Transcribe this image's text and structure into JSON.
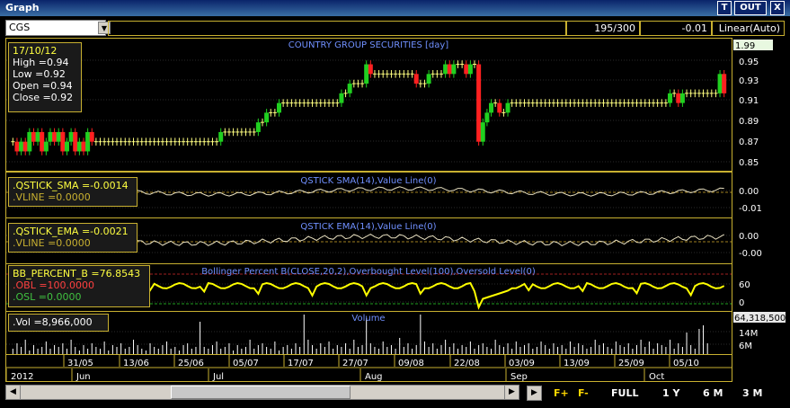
{
  "window": {
    "title": "Graph",
    "buttons": [
      "T",
      "OUT",
      "X"
    ]
  },
  "toolbar": {
    "symbol": "CGS",
    "records": "195/300",
    "change": "-0.01",
    "scale": "Linear(Auto)"
  },
  "price_panel": {
    "title": "COUNTRY GROUP SECURITIES [day]",
    "info": {
      "date": "17/10/12",
      "high": "High  =0.94",
      "low": "Low   =0.92",
      "open": "Open  =0.94",
      "close": "Close =0.92"
    },
    "current": "1.99",
    "ticks": [
      "0.95",
      "0.93",
      "0.91",
      "0.89",
      "0.87",
      "0.85"
    ]
  },
  "sma_panel": {
    "title": "QSTICK SMA(14),Value Line(0)",
    "info": {
      "line1": ".QSTICK_SMA   =-0.0014",
      "line2": ".VLINE  =0.0000"
    },
    "ticks": [
      "0.00",
      "-0.01"
    ]
  },
  "ema_panel": {
    "title": "QSTICK EMA(14),Value Line(0)",
    "info": {
      "line1": ".QSTICK_EMA   =-0.0021",
      "line2": ".VLINE  =0.0000"
    },
    "ticks": [
      "0.00",
      "-0.00"
    ]
  },
  "bb_panel": {
    "title": "Bollinger Percent B(CLOSE,20,2),Overbought Level(100),Oversold Level(0)",
    "info": {
      "line1": "BB_PERCENT_B   =76.8543",
      "line2": ".OBL  =100.0000",
      "line3": ".OSL   =0.0000"
    },
    "ticks": [
      "60",
      "0"
    ]
  },
  "vol_panel": {
    "title": "Volume",
    "info": {
      "line1": ".Vol   =8,966,000"
    },
    "current": "64,318,500",
    "ticks": [
      "14M",
      "6M"
    ]
  },
  "date_axis": {
    "days": [
      "31/05",
      "13/06",
      "25/06",
      "05/07",
      "17/07",
      "27/07",
      "09/08",
      "22/08",
      "03/09",
      "13/09",
      "25/09",
      "05/10"
    ],
    "months": [
      "2012",
      "Jun",
      "Jul",
      "Aug",
      "Sep",
      "Oct"
    ]
  },
  "bottom_buttons": {
    "fplus": "F+",
    "fminus": "F-",
    "full": "FULL",
    "y1": "1 Y",
    "m6": "6 M",
    "m3": "3 M"
  },
  "colors": {
    "up": "#ffff80",
    "down": "#ff2020",
    "bull": "#20d020",
    "line": "#e8e0b0",
    "bb": "#ffff00",
    "grid": "#303030",
    "panelborder": "#c8b030"
  },
  "chart_data": {
    "type": "candlestick",
    "title": "COUNTRY GROUP SECURITIES [day]",
    "close": [
      0.87,
      0.86,
      0.87,
      0.86,
      0.88,
      0.87,
      0.88,
      0.86,
      0.87,
      0.88,
      0.87,
      0.88,
      0.86,
      0.87,
      0.88,
      0.86,
      0.87,
      0.86,
      0.88,
      0.87,
      0.87,
      0.87,
      0.87,
      0.87,
      0.87,
      0.87,
      0.87,
      0.87,
      0.87,
      0.87,
      0.87,
      0.87,
      0.87,
      0.87,
      0.87,
      0.87,
      0.87,
      0.87,
      0.87,
      0.87,
      0.87,
      0.87,
      0.87,
      0.87,
      0.87,
      0.87,
      0.87,
      0.87,
      0.87,
      0.87,
      0.88,
      0.88,
      0.88,
      0.88,
      0.88,
      0.88,
      0.88,
      0.88,
      0.88,
      0.89,
      0.89,
      0.9,
      0.9,
      0.9,
      0.91,
      0.91,
      0.91,
      0.91,
      0.91,
      0.91,
      0.91,
      0.91,
      0.91,
      0.91,
      0.91,
      0.91,
      0.91,
      0.91,
      0.91,
      0.92,
      0.92,
      0.93,
      0.93,
      0.93,
      0.93,
      0.95,
      0.94,
      0.94,
      0.94,
      0.94,
      0.94,
      0.94,
      0.94,
      0.94,
      0.94,
      0.94,
      0.94,
      0.93,
      0.93,
      0.93,
      0.94,
      0.94,
      0.94,
      0.94,
      0.95,
      0.94,
      0.95,
      0.95,
      0.95,
      0.94,
      0.95,
      0.95,
      0.87,
      0.89,
      0.9,
      0.91,
      0.91,
      0.9,
      0.9,
      0.91,
      0.91,
      0.91,
      0.91,
      0.91,
      0.91,
      0.91,
      0.91,
      0.91,
      0.91,
      0.91,
      0.91,
      0.91,
      0.91,
      0.91,
      0.91,
      0.91,
      0.91,
      0.91,
      0.91,
      0.91,
      0.91,
      0.91,
      0.91,
      0.91,
      0.91,
      0.91,
      0.91,
      0.91,
      0.91,
      0.91,
      0.91,
      0.91,
      0.91,
      0.91,
      0.91,
      0.91,
      0.91,
      0.91,
      0.92,
      0.92,
      0.91,
      0.92,
      0.92,
      0.92,
      0.92,
      0.92,
      0.92,
      0.92,
      0.92,
      0.92,
      0.94,
      0.92
    ],
    "y_range": [
      0.84,
      0.97
    ],
    "volume": [
      3,
      6,
      4,
      8,
      2,
      5,
      3,
      4,
      7,
      3,
      5,
      4,
      6,
      3,
      8,
      4,
      2,
      5,
      3,
      6,
      4,
      3,
      7,
      2,
      5,
      4,
      6,
      3,
      4,
      8,
      5,
      3,
      2,
      6,
      4,
      3,
      5,
      7,
      3,
      4,
      2,
      5,
      6,
      3,
      4,
      18,
      4,
      3,
      5,
      7,
      3,
      4,
      6,
      2,
      5,
      3,
      4,
      8,
      3,
      5,
      6,
      4,
      3,
      7,
      2,
      4,
      5,
      3,
      6,
      4,
      22,
      8,
      5,
      3,
      6,
      4,
      7,
      3,
      5,
      4,
      6,
      3,
      8,
      4,
      5,
      20,
      6,
      4,
      3,
      7,
      4,
      5,
      3,
      9,
      4,
      6,
      3,
      5,
      22,
      7,
      4,
      6,
      3,
      5,
      8,
      4,
      6,
      3,
      5,
      4,
      7,
      3,
      5,
      6,
      4,
      3,
      8,
      5,
      4,
      6,
      3,
      7,
      4,
      5,
      6,
      3,
      4,
      7,
      5,
      3,
      6,
      4,
      5,
      3,
      7,
      4,
      6,
      5,
      3,
      4,
      8,
      5,
      6,
      4,
      3,
      7,
      5,
      4,
      6,
      3,
      5,
      8,
      4,
      7,
      3,
      6,
      5,
      4,
      8,
      3,
      6,
      4,
      12,
      5,
      3,
      14,
      16,
      6
    ]
  }
}
